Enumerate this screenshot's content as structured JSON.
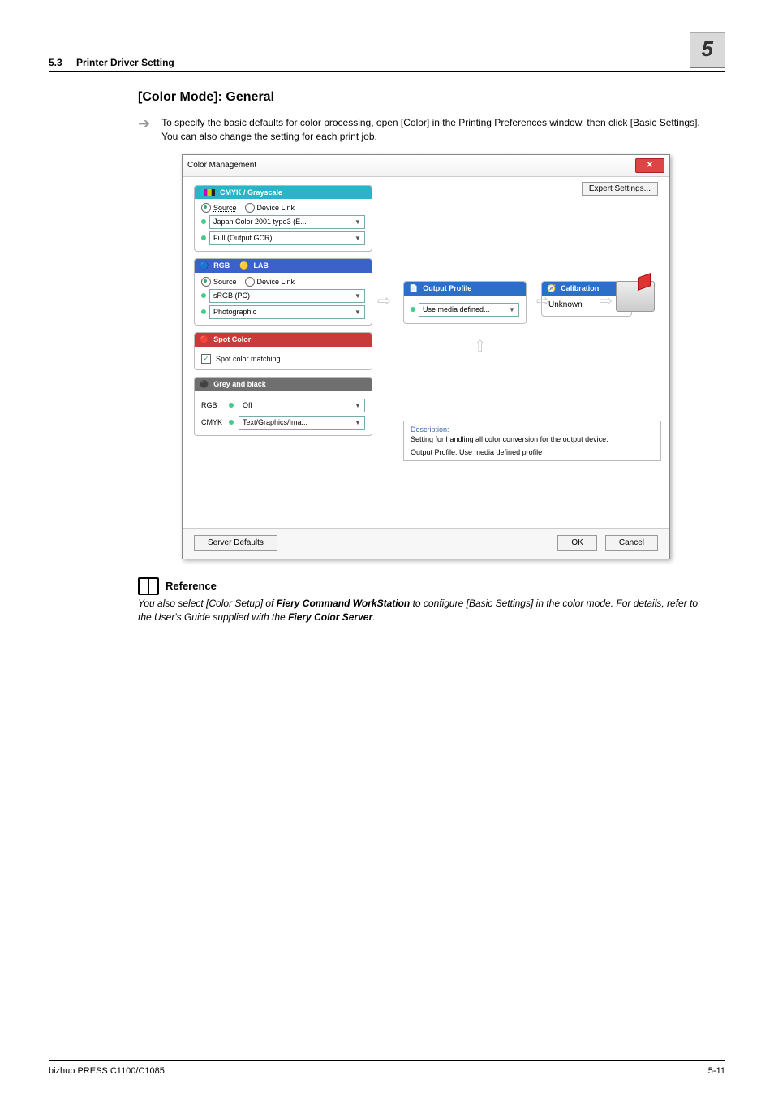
{
  "header": {
    "section_num": "5.3",
    "section_title": "Printer Driver Setting",
    "chapter_badge": "5"
  },
  "section": {
    "heading": "[Color Mode]: General",
    "intro": "To specify the basic defaults for color processing, open [Color] in the Printing Preferences window, then click [Basic Settings]. You can also change the setting for each print job."
  },
  "dialog": {
    "title": "Color Management",
    "expert_button": "Expert Settings...",
    "panels": {
      "cmyk": {
        "title": "CMYK / Grayscale",
        "radio_source": "Source",
        "radio_devicelink": "Device Link",
        "value1": "Japan Color 2001 type3 (E...",
        "value2": "Full (Output GCR)"
      },
      "rgb": {
        "title": "RGB",
        "tab2": "LAB",
        "radio_source": "Source",
        "radio_devicelink": "Device Link",
        "value1": "sRGB (PC)",
        "value2": "Photographic"
      },
      "spot": {
        "title": "Spot Color",
        "checkbox_label": "Spot color matching"
      },
      "grey": {
        "title": "Grey and black",
        "rgb_label": "RGB",
        "rgb_value": "Off",
        "cmyk_label": "CMYK",
        "cmyk_value": "Text/Graphics/Ima..."
      },
      "output": {
        "title": "Output Profile",
        "value": "Use media defined..."
      },
      "calibration": {
        "title": "Calibration",
        "value": "Unknown"
      }
    },
    "description": {
      "label": "Description:",
      "line1": "Setting for handling all color conversion for the output device.",
      "line2": "Output Profile: Use media defined profile"
    },
    "footer": {
      "server_defaults": "Server Defaults",
      "ok": "OK",
      "cancel": "Cancel"
    }
  },
  "reference": {
    "label": "Reference",
    "text_before": "You also select [Color Setup] of ",
    "bold1": "Fiery Command WorkStation",
    "text_mid": " to configure [Basic Settings] in the color mode. For details, refer to the User's Guide supplied with the ",
    "bold2": "Fiery Color Server",
    "text_after": "."
  },
  "footer": {
    "product": "bizhub PRESS C1100/C1085",
    "page": "5-11"
  }
}
